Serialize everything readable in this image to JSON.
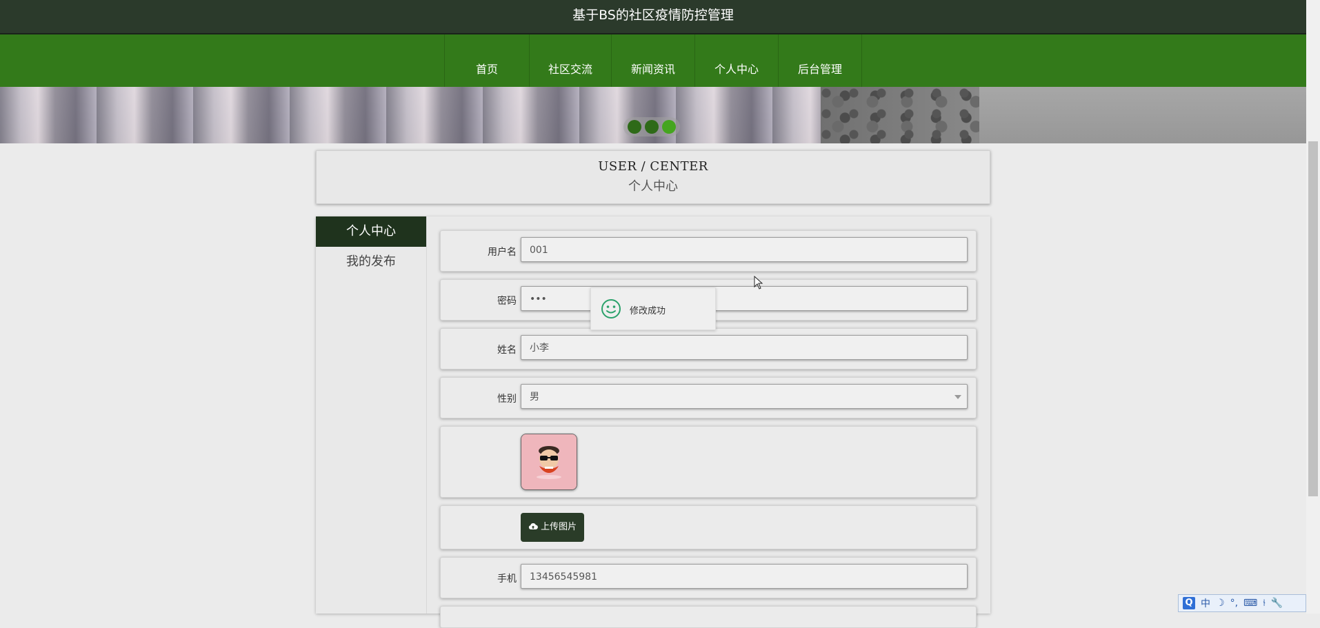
{
  "site": {
    "title": "基于BS的社区疫情防控管理"
  },
  "nav": {
    "items": [
      {
        "label": "首页",
        "width": 122
      },
      {
        "label": "社区交流",
        "width": 118
      },
      {
        "label": "新闻资讯",
        "width": 120
      },
      {
        "label": "个人中心",
        "width": 120
      },
      {
        "label": "后台管理",
        "width": 120
      }
    ]
  },
  "banner": {
    "active_slide": 3,
    "slide_count": 3
  },
  "page_title": {
    "en": "USER / CENTER",
    "zh": "个人中心"
  },
  "sidebar": {
    "items": [
      {
        "label": "个人中心",
        "active": true
      },
      {
        "label": "我的发布",
        "active": false
      }
    ]
  },
  "form": {
    "username": {
      "label": "用户名",
      "value": "001"
    },
    "password": {
      "label": "密码",
      "value": "•••"
    },
    "name": {
      "label": "姓名",
      "value": "小李"
    },
    "gender": {
      "label": "性别",
      "value": "男"
    },
    "upload": {
      "label": "上传图片"
    },
    "phone": {
      "label": "手机",
      "value": "13456545981"
    }
  },
  "toast": {
    "message": "修改成功"
  },
  "ime": {
    "mode": "中"
  },
  "colors": {
    "nav_green": "#337a1a",
    "dark_header": "#2b3a2b",
    "active_menu": "#1f331d"
  }
}
